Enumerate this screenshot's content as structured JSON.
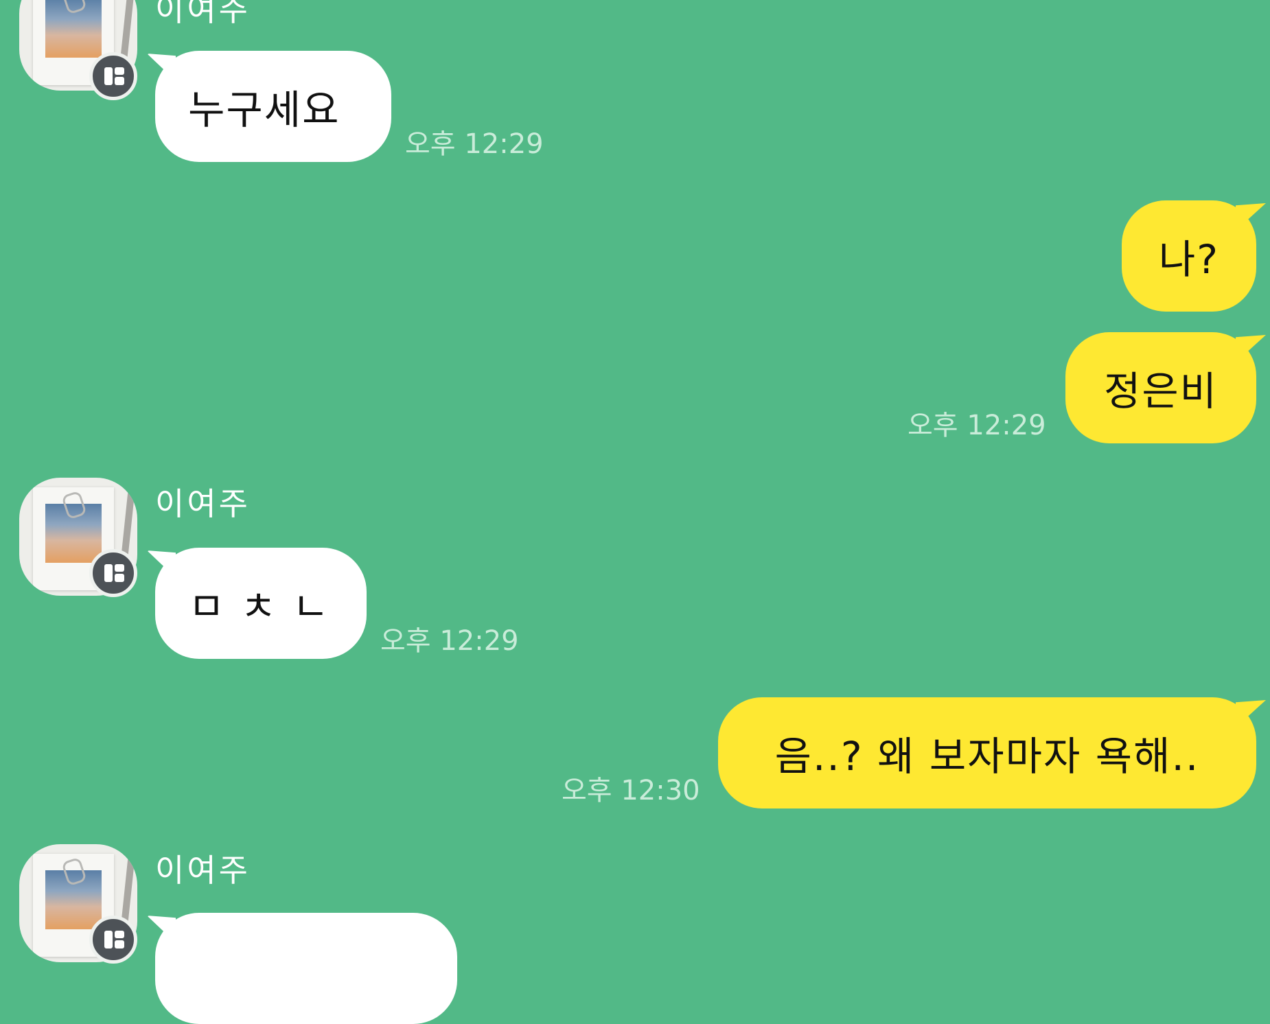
{
  "colors": {
    "background": "#52b987",
    "incoming_bubble": "#ffffff",
    "outgoing_bubble": "#fee832",
    "timestamp": "#c9ecd9"
  },
  "chat": {
    "messages": [
      {
        "direction": "incoming",
        "sender": "이여주",
        "text": "누구세요",
        "time": "오후 12:29"
      },
      {
        "direction": "outgoing",
        "text": "나?",
        "time": ""
      },
      {
        "direction": "outgoing",
        "text": "정은비",
        "time": "오후 12:29"
      },
      {
        "direction": "incoming",
        "sender": "이여주",
        "text": "ㅁ ㅊ ㄴ",
        "time": "오후 12:29"
      },
      {
        "direction": "outgoing",
        "text": "음..? 왜 보자마자 욕해..",
        "time": "오후 12:30"
      },
      {
        "direction": "incoming",
        "sender": "이여주",
        "text": "",
        "time": ""
      }
    ]
  }
}
